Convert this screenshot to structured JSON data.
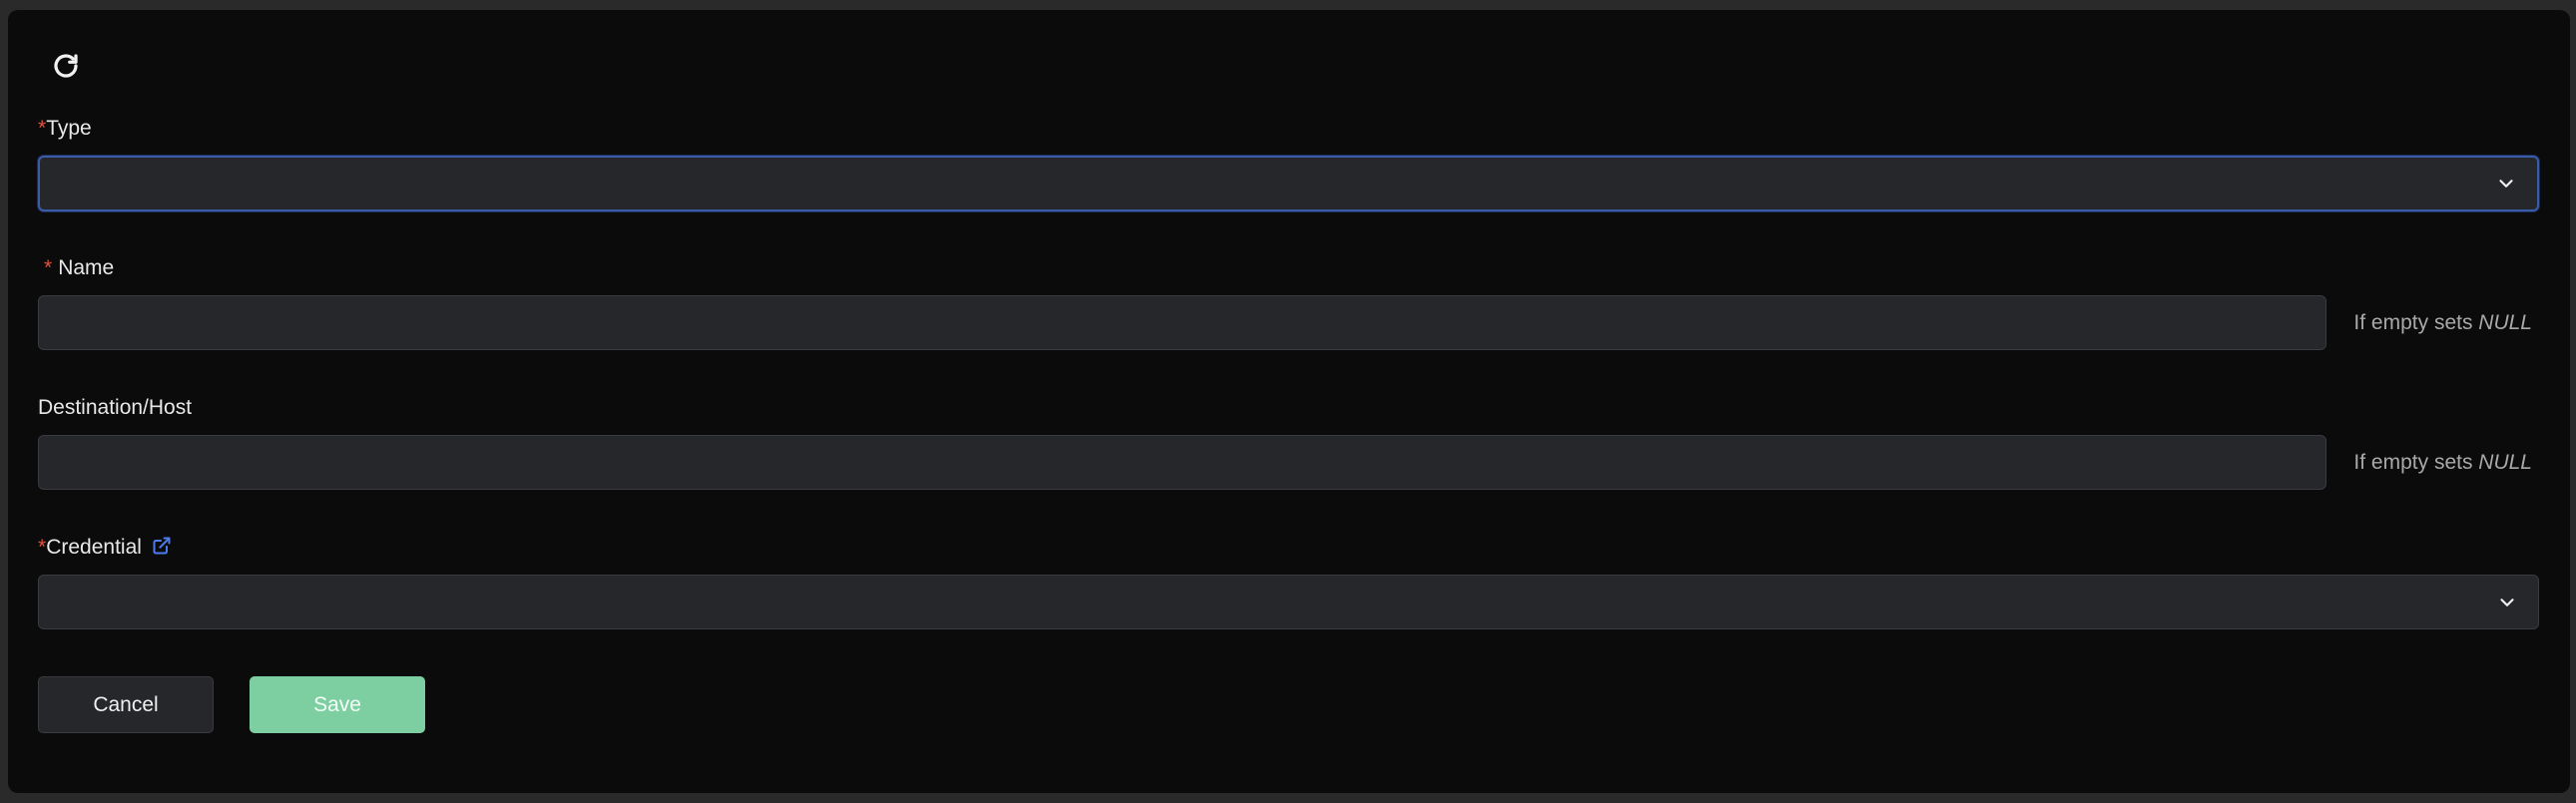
{
  "form": {
    "type": {
      "required_mark": "*",
      "label": "Type",
      "value": ""
    },
    "name": {
      "required_mark": "*",
      "label": "Name",
      "value": "",
      "hint_prefix": "If empty sets ",
      "hint_value": "NULL"
    },
    "destination": {
      "label": "Destination/Host",
      "value": "",
      "hint_prefix": "If empty sets ",
      "hint_value": "NULL"
    },
    "credential": {
      "required_mark": "*",
      "label": "Credential",
      "value": ""
    }
  },
  "actions": {
    "cancel_label": "Cancel",
    "save_label": "Save"
  },
  "icons": {
    "refresh": "refresh-icon",
    "chevron": "chevron-down-icon",
    "external_link": "external-link-icon"
  },
  "colors": {
    "required": "#e5533d",
    "accent_link": "#4d7cf0",
    "save_button": "#7dcfa2",
    "focus_border": "#3a5ba8"
  }
}
